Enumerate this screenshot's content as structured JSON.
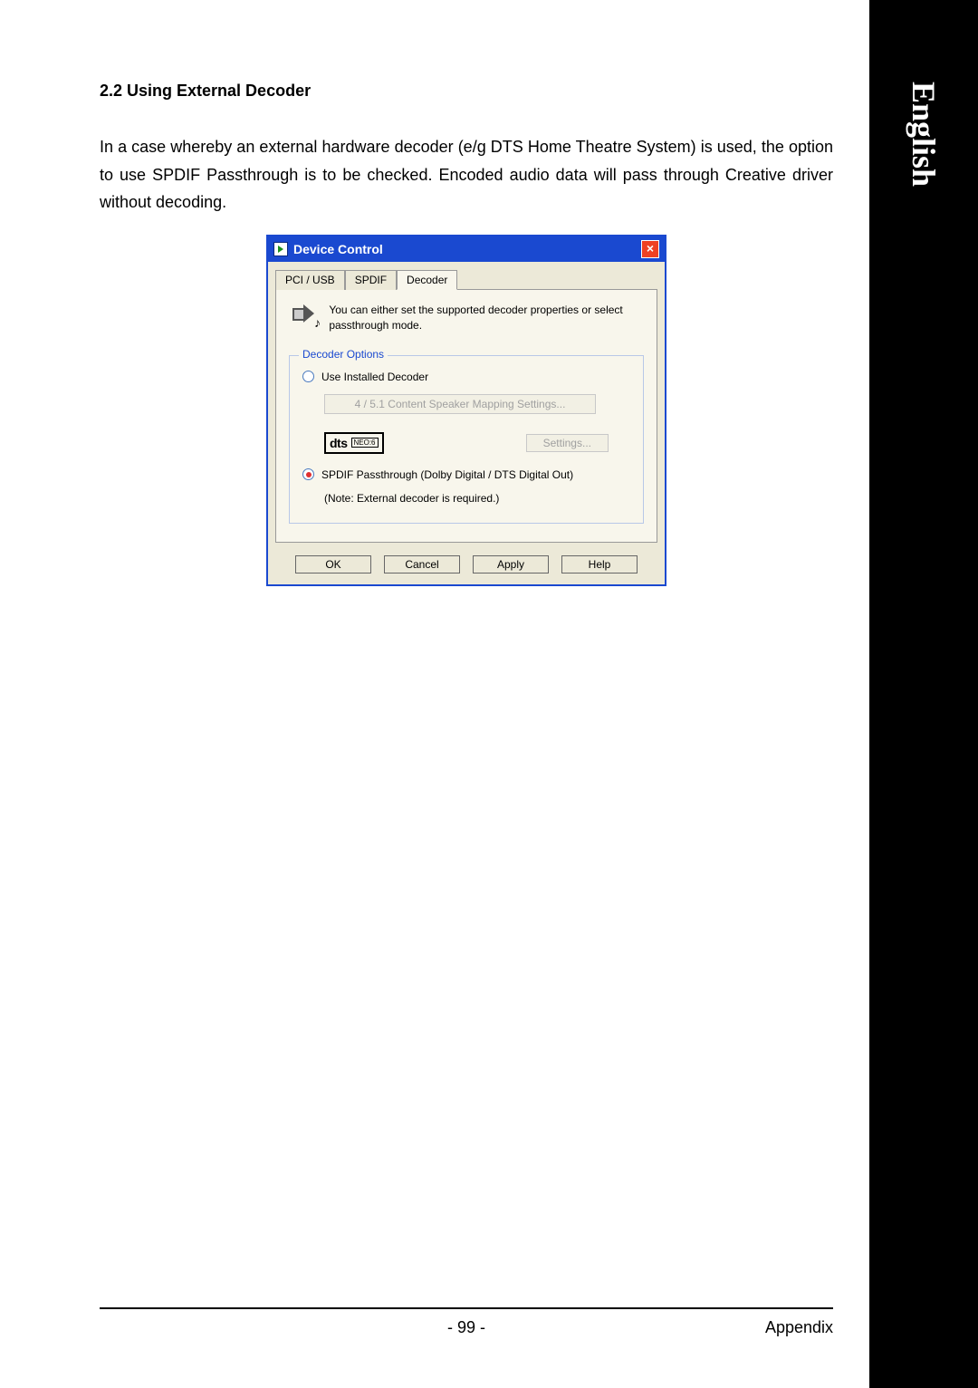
{
  "sideTab": "English",
  "section": {
    "heading": "2.2  Using External Decoder",
    "body": "In  a case whereby an external hardware decoder (e/g DTS Home Theatre System) is used, the option to use SPDIF Passthrough is to be checked. Encoded audio data will pass through Creative driver without decoding."
  },
  "dialog": {
    "title": "Device Control",
    "tabs": [
      "PCI / USB",
      "SPDIF",
      "Decoder"
    ],
    "activeTab": 2,
    "intro": "You can either set the supported decoder properties or select passthrough mode.",
    "groupLegend": "Decoder Options",
    "radio1": {
      "label": "Use Installed Decoder",
      "checked": false
    },
    "mappingBtn": "4 / 5.1 Content Speaker Mapping Settings...",
    "dtsLabel": "dts",
    "dtsSub": "NEO:6",
    "settingsBtn": "Settings...",
    "radio2": {
      "label": "SPDIF Passthrough (Dolby Digital / DTS Digital Out)",
      "checked": true
    },
    "radio2note": "(Note: External decoder is required.)",
    "buttons": {
      "ok": "OK",
      "cancel": "Cancel",
      "apply": "Apply",
      "help": "Help"
    }
  },
  "footer": {
    "page": "- 99 -",
    "section": "Appendix"
  }
}
